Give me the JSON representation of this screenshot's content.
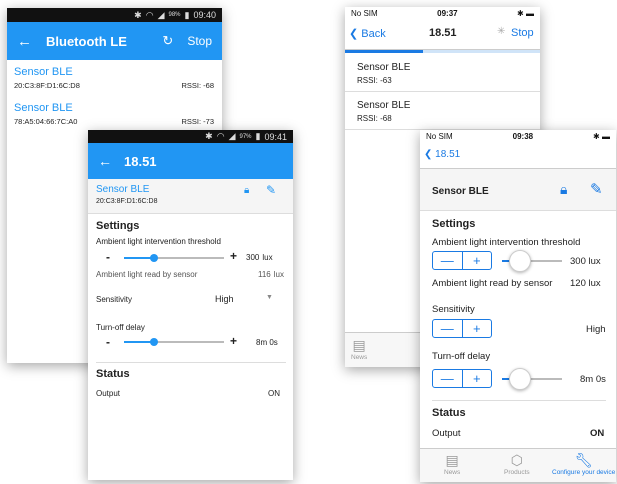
{
  "android_scan": {
    "status_time": "09:40",
    "status_battery": "98%",
    "title": "Bluetooth LE",
    "stop_label": "Stop",
    "devices": [
      {
        "name": "Sensor BLE",
        "mac": "20:C3:8F:D1:6C:D8",
        "rssi": "RSSI: -68"
      },
      {
        "name": "Sensor BLE",
        "mac": "78:A5:04:66:7C:A0",
        "rssi": "RSSI: -73"
      }
    ]
  },
  "android_device": {
    "status_time": "09:41",
    "status_battery": "97%",
    "title": "18.51",
    "device_name": "Sensor BLE",
    "device_mac": "20:C3:8F:D1:6C:D8",
    "settings_heading": "Settings",
    "threshold_label": "Ambient light intervention threshold",
    "threshold_value": "300",
    "threshold_unit": "lux",
    "threshold_position": 0.3,
    "read_label": "Ambient light read by sensor",
    "read_value": "116",
    "read_unit": "lux",
    "sensitivity_label": "Sensitivity",
    "sensitivity_value": "High",
    "delay_label": "Turn-off delay",
    "delay_value": "8m 0s",
    "delay_position": 0.3,
    "status_heading": "Status",
    "output_label": "Output",
    "output_value": "ON",
    "minus": "-",
    "plus": "+"
  },
  "ios_scan": {
    "carrier": "No SIM",
    "time": "09:37",
    "back_label": "Back",
    "title": "18.51",
    "stop_label": "Stop",
    "devices": [
      {
        "name": "Sensor BLE",
        "rssi": "RSSI: -63"
      },
      {
        "name": "Sensor BLE",
        "rssi": "RSSI: -68"
      }
    ],
    "tab_news": "News"
  },
  "ios_device": {
    "carrier": "No SIM",
    "time": "09:38",
    "back_label": "18.51",
    "device_name": "Sensor BLE",
    "settings_heading": "Settings",
    "threshold_label": "Ambient light intervention threshold",
    "threshold_value": "300 lux",
    "threshold_position": 0.3,
    "read_label": "Ambient light read by sensor",
    "read_value": "120 lux",
    "sensitivity_label": "Sensitivity",
    "sensitivity_value": "High",
    "delay_label": "Turn-off delay",
    "delay_value": "8m 0s",
    "delay_position": 0.3,
    "status_heading": "Status",
    "output_label": "Output",
    "output_value": "ON",
    "minus": "—",
    "plus": "+",
    "tabs": [
      "News",
      "Products",
      "Configure your device"
    ]
  },
  "colors": {
    "android_primary": "#2196F3",
    "ios_tint": "#1a7ae3"
  }
}
